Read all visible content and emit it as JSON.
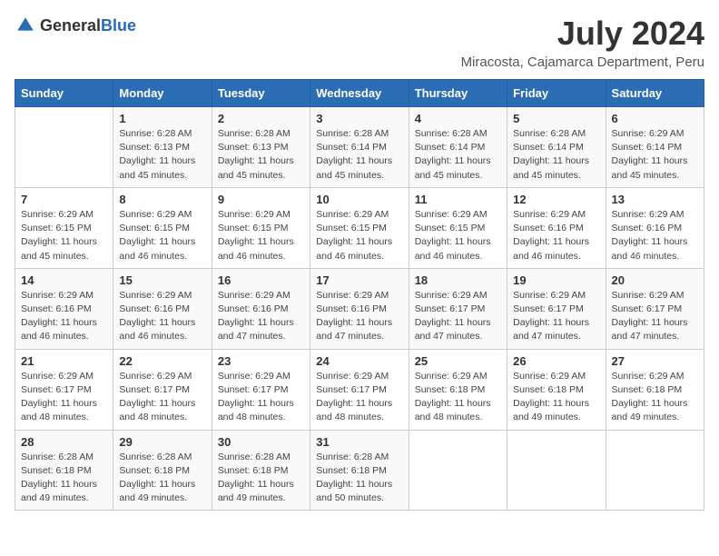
{
  "logo": {
    "text_general": "General",
    "text_blue": "Blue"
  },
  "title": "July 2024",
  "location": "Miracosta, Cajamarca Department, Peru",
  "header_days": [
    "Sunday",
    "Monday",
    "Tuesday",
    "Wednesday",
    "Thursday",
    "Friday",
    "Saturday"
  ],
  "weeks": [
    [
      {
        "day": "",
        "info": ""
      },
      {
        "day": "1",
        "info": "Sunrise: 6:28 AM\nSunset: 6:13 PM\nDaylight: 11 hours\nand 45 minutes."
      },
      {
        "day": "2",
        "info": "Sunrise: 6:28 AM\nSunset: 6:13 PM\nDaylight: 11 hours\nand 45 minutes."
      },
      {
        "day": "3",
        "info": "Sunrise: 6:28 AM\nSunset: 6:14 PM\nDaylight: 11 hours\nand 45 minutes."
      },
      {
        "day": "4",
        "info": "Sunrise: 6:28 AM\nSunset: 6:14 PM\nDaylight: 11 hours\nand 45 minutes."
      },
      {
        "day": "5",
        "info": "Sunrise: 6:28 AM\nSunset: 6:14 PM\nDaylight: 11 hours\nand 45 minutes."
      },
      {
        "day": "6",
        "info": "Sunrise: 6:29 AM\nSunset: 6:14 PM\nDaylight: 11 hours\nand 45 minutes."
      }
    ],
    [
      {
        "day": "7",
        "info": "Sunrise: 6:29 AM\nSunset: 6:15 PM\nDaylight: 11 hours\nand 45 minutes."
      },
      {
        "day": "8",
        "info": "Sunrise: 6:29 AM\nSunset: 6:15 PM\nDaylight: 11 hours\nand 46 minutes."
      },
      {
        "day": "9",
        "info": "Sunrise: 6:29 AM\nSunset: 6:15 PM\nDaylight: 11 hours\nand 46 minutes."
      },
      {
        "day": "10",
        "info": "Sunrise: 6:29 AM\nSunset: 6:15 PM\nDaylight: 11 hours\nand 46 minutes."
      },
      {
        "day": "11",
        "info": "Sunrise: 6:29 AM\nSunset: 6:15 PM\nDaylight: 11 hours\nand 46 minutes."
      },
      {
        "day": "12",
        "info": "Sunrise: 6:29 AM\nSunset: 6:16 PM\nDaylight: 11 hours\nand 46 minutes."
      },
      {
        "day": "13",
        "info": "Sunrise: 6:29 AM\nSunset: 6:16 PM\nDaylight: 11 hours\nand 46 minutes."
      }
    ],
    [
      {
        "day": "14",
        "info": "Sunrise: 6:29 AM\nSunset: 6:16 PM\nDaylight: 11 hours\nand 46 minutes."
      },
      {
        "day": "15",
        "info": "Sunrise: 6:29 AM\nSunset: 6:16 PM\nDaylight: 11 hours\nand 46 minutes."
      },
      {
        "day": "16",
        "info": "Sunrise: 6:29 AM\nSunset: 6:16 PM\nDaylight: 11 hours\nand 47 minutes."
      },
      {
        "day": "17",
        "info": "Sunrise: 6:29 AM\nSunset: 6:16 PM\nDaylight: 11 hours\nand 47 minutes."
      },
      {
        "day": "18",
        "info": "Sunrise: 6:29 AM\nSunset: 6:17 PM\nDaylight: 11 hours\nand 47 minutes."
      },
      {
        "day": "19",
        "info": "Sunrise: 6:29 AM\nSunset: 6:17 PM\nDaylight: 11 hours\nand 47 minutes."
      },
      {
        "day": "20",
        "info": "Sunrise: 6:29 AM\nSunset: 6:17 PM\nDaylight: 11 hours\nand 47 minutes."
      }
    ],
    [
      {
        "day": "21",
        "info": "Sunrise: 6:29 AM\nSunset: 6:17 PM\nDaylight: 11 hours\nand 48 minutes."
      },
      {
        "day": "22",
        "info": "Sunrise: 6:29 AM\nSunset: 6:17 PM\nDaylight: 11 hours\nand 48 minutes."
      },
      {
        "day": "23",
        "info": "Sunrise: 6:29 AM\nSunset: 6:17 PM\nDaylight: 11 hours\nand 48 minutes."
      },
      {
        "day": "24",
        "info": "Sunrise: 6:29 AM\nSunset: 6:17 PM\nDaylight: 11 hours\nand 48 minutes."
      },
      {
        "day": "25",
        "info": "Sunrise: 6:29 AM\nSunset: 6:18 PM\nDaylight: 11 hours\nand 48 minutes."
      },
      {
        "day": "26",
        "info": "Sunrise: 6:29 AM\nSunset: 6:18 PM\nDaylight: 11 hours\nand 49 minutes."
      },
      {
        "day": "27",
        "info": "Sunrise: 6:29 AM\nSunset: 6:18 PM\nDaylight: 11 hours\nand 49 minutes."
      }
    ],
    [
      {
        "day": "28",
        "info": "Sunrise: 6:28 AM\nSunset: 6:18 PM\nDaylight: 11 hours\nand 49 minutes."
      },
      {
        "day": "29",
        "info": "Sunrise: 6:28 AM\nSunset: 6:18 PM\nDaylight: 11 hours\nand 49 minutes."
      },
      {
        "day": "30",
        "info": "Sunrise: 6:28 AM\nSunset: 6:18 PM\nDaylight: 11 hours\nand 49 minutes."
      },
      {
        "day": "31",
        "info": "Sunrise: 6:28 AM\nSunset: 6:18 PM\nDaylight: 11 hours\nand 50 minutes."
      },
      {
        "day": "",
        "info": ""
      },
      {
        "day": "",
        "info": ""
      },
      {
        "day": "",
        "info": ""
      }
    ]
  ]
}
